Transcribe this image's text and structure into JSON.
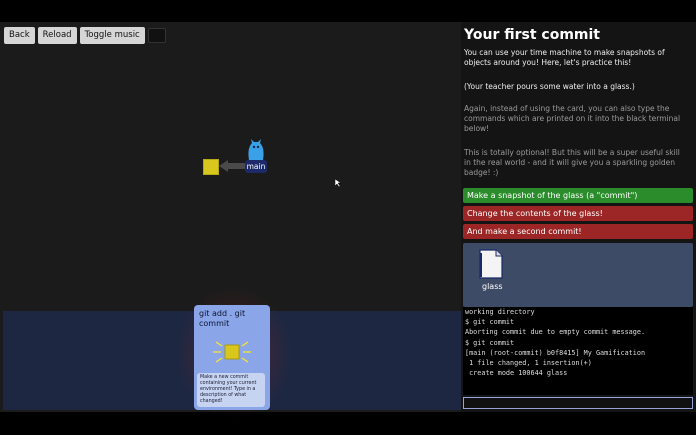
{
  "toolbar": {
    "back_label": "Back",
    "reload_label": "Reload",
    "toggle_music_label": "Toggle music"
  },
  "graph": {
    "branch_label": "main"
  },
  "card": {
    "title": "git add . git commit",
    "description": "Make a new commit containing your current environment! Type in a description of what changed!"
  },
  "panel": {
    "title": "Your first commit",
    "intro": "You can use your time machine to make snapshots of objects around you! Here, let's practice this!",
    "teacher": "(Your teacher pours some water into a glass.)",
    "hint": "Again, instead of using the card, you can also type the commands which are printed on it into the black terminal below!",
    "optional": "This is totally optional! But this will be a super useful skill in the real world - and it will give you a sparkling golden badge! :)",
    "tasks": [
      {
        "label": "Make a snapshot of the glass (a \"commit\")",
        "status": "done"
      },
      {
        "label": "Change the contents of the glass!",
        "status": "todo"
      },
      {
        "label": "And make a second commit!",
        "status": "todo"
      }
    ],
    "inventory": {
      "file_label": "glass",
      "file_icon": "document-icon"
    },
    "terminal_lines": [
      "working directory",
      "$ git commit",
      "Aborting commit due to empty commit message.",
      "$ git commit",
      "[main (root-commit) b0f8415] My Gamification",
      " 1 file changed, 1 insertion(+)",
      " create mode 100644 glass"
    ]
  },
  "colors": {
    "task_done": "#2a8c2a",
    "task_todo": "#9c2525",
    "commit_node": "#d8c71d",
    "branch_badge": "#1d2a6a",
    "card": "#8aa6e8"
  }
}
